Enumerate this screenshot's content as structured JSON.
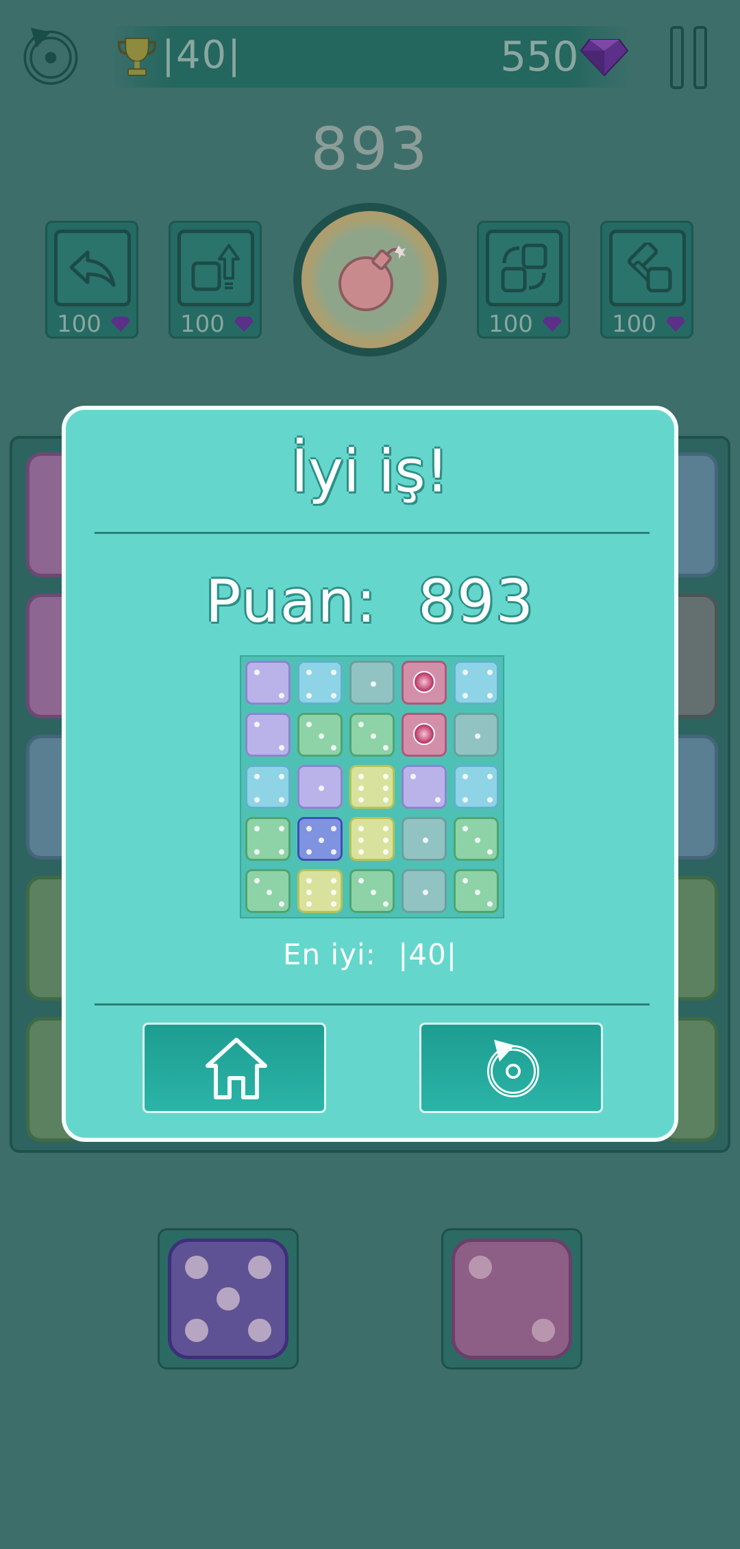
{
  "header": {
    "best_score": "|40|",
    "gems": "550",
    "current_score": "893"
  },
  "boosters": [
    {
      "name": "undo",
      "price": "100"
    },
    {
      "name": "push",
      "price": "100"
    },
    {
      "name": "bomb",
      "price": ""
    },
    {
      "name": "swap",
      "price": "100"
    },
    {
      "name": "hammer",
      "price": "100"
    }
  ],
  "colors": {
    "background": "#3d6e6a",
    "modal": "#65d6cc",
    "button": "#1e9d91"
  },
  "modal": {
    "title": "İyi iş!",
    "score_label": "Puan:",
    "score_value": "893",
    "best_label": "En iyi:",
    "best_value": "|40|",
    "home_icon": "home-icon",
    "restart_icon": "restart-icon"
  },
  "mini_board": [
    [
      "purple-2",
      "blue-4",
      "gray-1",
      "red-gem",
      "blue-4"
    ],
    [
      "purple-2",
      "green-3",
      "green-3",
      "red-gem",
      "gray-1"
    ],
    [
      "blue-4",
      "purple-1",
      "yellow-6",
      "purple-2",
      "blue-4"
    ],
    [
      "green-4",
      "navy-5",
      "yellow-6",
      "gray-1",
      "green-3"
    ],
    [
      "green-3",
      "yellow-6",
      "green-3",
      "gray-1",
      "green-3"
    ]
  ],
  "next_pieces": [
    {
      "color": "purple",
      "pips": 5
    },
    {
      "color": "pink",
      "pips": 2
    }
  ]
}
